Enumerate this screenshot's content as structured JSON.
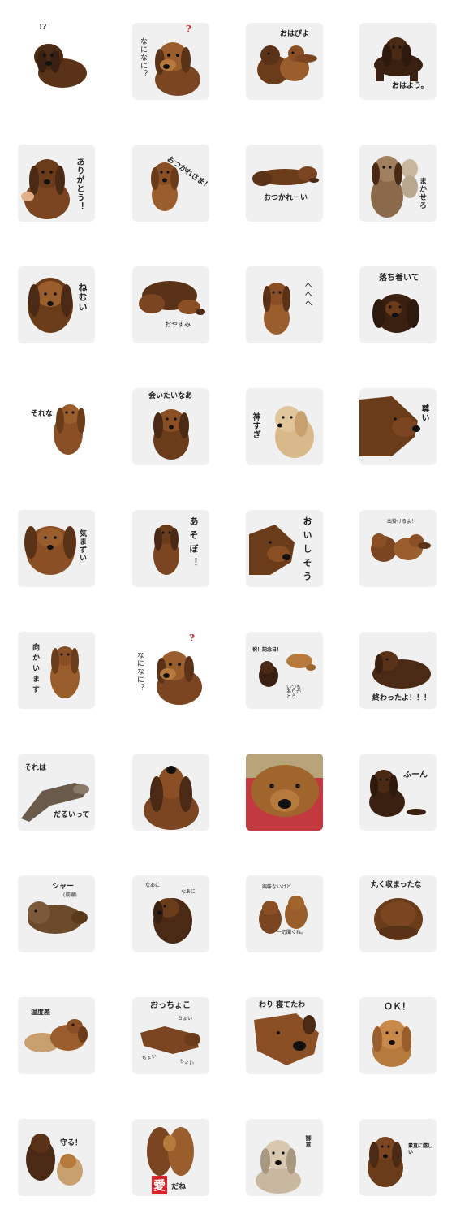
{
  "stickers": [
    {
      "caption": "!?",
      "mood": "surprised"
    },
    {
      "caption": "なになに？",
      "mark": "?",
      "mood": "curious"
    },
    {
      "caption": "おはぴよ",
      "mood": "morning"
    },
    {
      "caption": "おはよう。",
      "mood": "morning"
    },
    {
      "caption": "ありがとう！",
      "mood": "thanks"
    },
    {
      "caption": "おつかれさま！",
      "mood": "tired"
    },
    {
      "caption": "おつかれーい",
      "mood": "relaxed"
    },
    {
      "caption": "まかせろ",
      "mood": "confident"
    },
    {
      "caption": "ねむい",
      "mood": "sleepy"
    },
    {
      "caption": "おやすみ",
      "mood": "sleepy"
    },
    {
      "caption": "へへへ",
      "mood": "happy"
    },
    {
      "caption": "落ち着いて",
      "mood": "calm"
    },
    {
      "caption": "それな",
      "mood": "agree"
    },
    {
      "caption": "会いたいなあ",
      "mood": "miss"
    },
    {
      "caption": "神すぎ",
      "mood": "praise"
    },
    {
      "caption": "尊い",
      "mood": "praise"
    },
    {
      "caption": "気まずい",
      "mood": "awkward"
    },
    {
      "caption": "あそぼ！",
      "mood": "play"
    },
    {
      "caption": "おいしそう",
      "mood": "hungry"
    },
    {
      "caption": "出掛けるよ！",
      "mood": "go"
    },
    {
      "caption": "向かいます",
      "mood": "go"
    },
    {
      "caption": "なになに？",
      "mark": "?",
      "mood": "curious"
    },
    {
      "caption": "祝！記念日！",
      "sub": "いつもありがとう",
      "mood": "celebrate"
    },
    {
      "caption": "終わったよ！！！",
      "mood": "done"
    },
    {
      "caption": "それは",
      "sub": "だるいって",
      "mood": "lazy"
    },
    {
      "caption": "",
      "mood": "howl"
    },
    {
      "caption": "",
      "mood": "closeup"
    },
    {
      "caption": "ふーん",
      "mood": "indifferent"
    },
    {
      "caption": "シャー",
      "sub": "(威嚇)",
      "mood": "angry"
    },
    {
      "caption": "なあに",
      "sub": "なあに",
      "mood": "curious"
    },
    {
      "caption": "興味ないけど",
      "sub": "一応聞くね。",
      "mood": "indifferent"
    },
    {
      "caption": "丸く収まったな",
      "mood": "round"
    },
    {
      "caption": "温度差",
      "mood": "contrast"
    },
    {
      "caption": "おっちょこ",
      "sub": "ちょい",
      "mood": "clumsy"
    },
    {
      "caption": "わり 寝てたわ",
      "mood": "sleepy"
    },
    {
      "caption": "ＯＫ！",
      "mood": "ok"
    },
    {
      "caption": "守る！",
      "mood": "protect"
    },
    {
      "caption": "愛",
      "sub": "だね",
      "mood": "love"
    },
    {
      "caption": "御意",
      "mood": "agree"
    },
    {
      "caption": "素直に嬉しい",
      "mood": "happy"
    }
  ],
  "colors": {
    "tile_bg": "#f0f0f0",
    "fur_dark": "#4a2a14",
    "fur_mid": "#7a4520",
    "fur_light": "#b77a3d",
    "fur_cream": "#d8b98a",
    "accent_red": "#d8232a",
    "blanket_red": "#c23a3f"
  }
}
